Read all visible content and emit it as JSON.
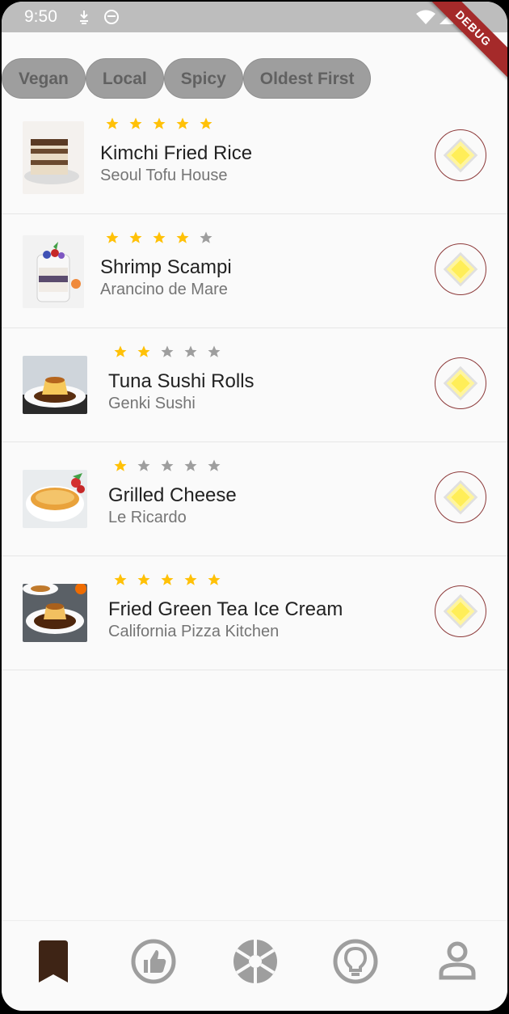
{
  "status_bar": {
    "time": "9:50",
    "debug_label": "DEBUG"
  },
  "filters": [
    {
      "label": "Vegan"
    },
    {
      "label": "Local"
    },
    {
      "label": "Spicy"
    },
    {
      "label": "Oldest First"
    }
  ],
  "dishes": [
    {
      "name": "Kimchi Fried Rice",
      "restaurant": "Seoul Tofu House",
      "rating": 5
    },
    {
      "name": "Shrimp Scampi",
      "restaurant": "Arancino de Mare",
      "rating": 4
    },
    {
      "name": "Tuna Sushi Rolls",
      "restaurant": "Genki Sushi",
      "rating": 2
    },
    {
      "name": "Grilled Cheese",
      "restaurant": "Le Ricardo",
      "rating": 1
    },
    {
      "name": "Fried Green Tea Ice Cream",
      "restaurant": "California Pizza Kitchen",
      "rating": 5
    }
  ],
  "bottom_nav": [
    {
      "icon": "bookmark-icon",
      "active": true
    },
    {
      "icon": "thumb-up-icon",
      "active": false
    },
    {
      "icon": "camera-shutter-icon",
      "active": false
    },
    {
      "icon": "lightbulb-icon",
      "active": false
    },
    {
      "icon": "person-icon",
      "active": false
    }
  ],
  "colors": {
    "star_on": "#ffc107",
    "star_off": "#9e9e9e",
    "nav_active": "#3e2415",
    "nav_inactive": "#9e9e9e",
    "chip_bg": "#9e9e9e"
  }
}
